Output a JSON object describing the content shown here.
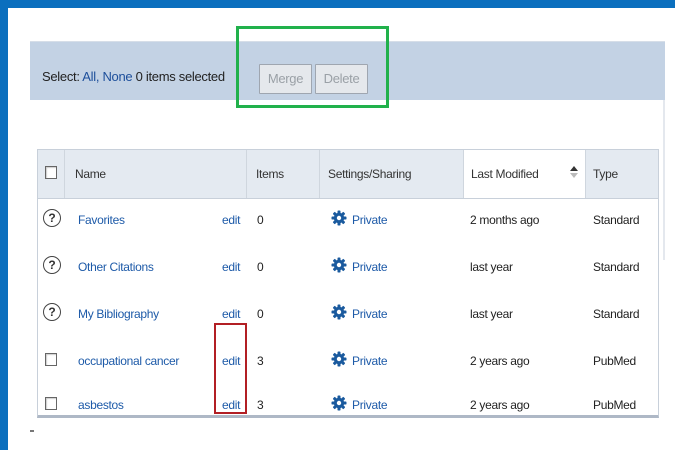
{
  "toolbar": {
    "select_label": "Select:",
    "all_link": "All,",
    "none_link": "None",
    "items_selected": "0 items selected",
    "merge_label": "Merge",
    "delete_label": "Delete"
  },
  "table": {
    "headers": {
      "name": "Name",
      "items": "Items",
      "settings": "Settings/Sharing",
      "last_modified": "Last Modified",
      "type": "Type"
    },
    "rows": [
      {
        "name": "Favorites",
        "edit": "edit",
        "items": "0",
        "sharing": "Private",
        "modified": "2 months ago",
        "type": "Standard",
        "marker": "help-icon"
      },
      {
        "name": "Other Citations",
        "edit": "edit",
        "items": "0",
        "sharing": "Private",
        "modified": "last year",
        "type": "Standard",
        "marker": "help-icon"
      },
      {
        "name": "My Bibliography",
        "edit": "edit",
        "items": "0",
        "sharing": "Private",
        "modified": "last year",
        "type": "Standard",
        "marker": "help-icon"
      },
      {
        "name": "occupational cancer",
        "edit": "edit",
        "items": "3",
        "sharing": "Private",
        "modified": "2 years ago",
        "type": "PubMed",
        "marker": "checkbox"
      },
      {
        "name": "asbestos",
        "edit": "edit",
        "items": "3",
        "sharing": "Private",
        "modified": "2 years ago",
        "type": "PubMed",
        "marker": "checkbox"
      }
    ]
  },
  "colors": {
    "frame": "#0b6fbe",
    "toolbar_bg": "#c3d2e4",
    "link": "#1d5aa8",
    "highlight_green": "#21b14b",
    "highlight_red": "#b21f24"
  },
  "help_icon_glyph": "?"
}
